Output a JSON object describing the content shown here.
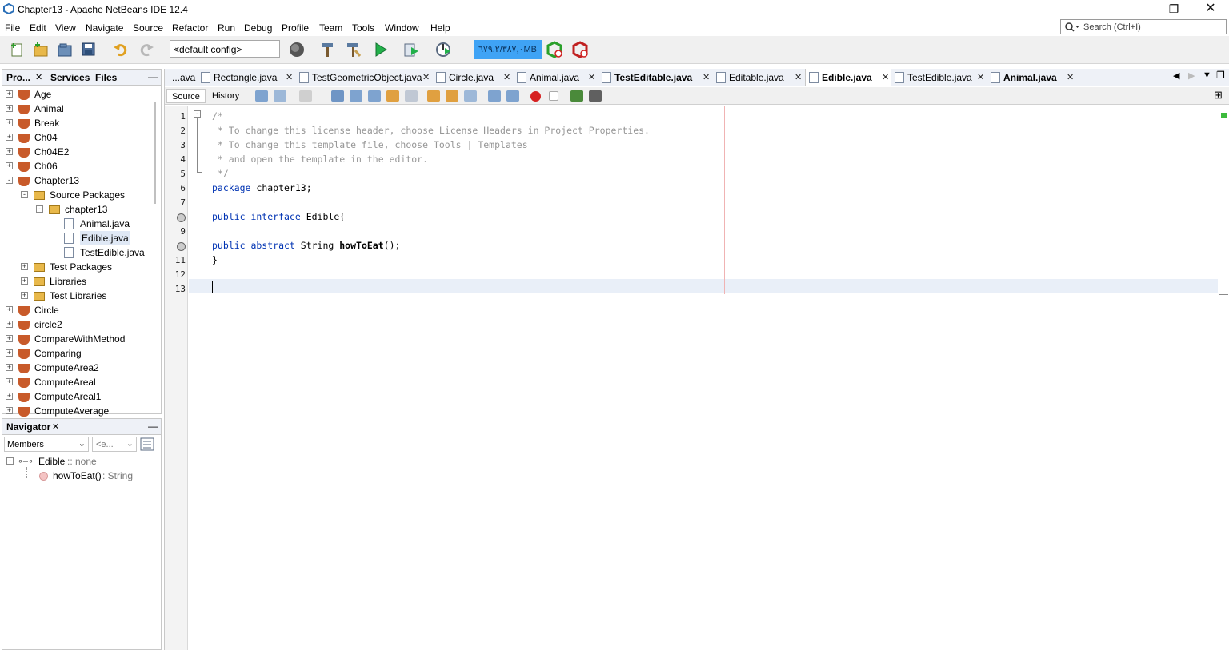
{
  "window": {
    "title": "Chapter13 - Apache NetBeans IDE 12.4"
  },
  "menu": [
    "File",
    "Edit",
    "View",
    "Navigate",
    "Source",
    "Refactor",
    "Run",
    "Debug",
    "Profile",
    "Team",
    "Tools",
    "Window",
    "Help"
  ],
  "search": {
    "placeholder": "Search (Ctrl+I)"
  },
  "toolbar": {
    "config": "<default config>",
    "memory": "٦٧٩.٢/٣٨٧,٠MB"
  },
  "projects_panel": {
    "tabs": [
      "Pro...",
      "Services",
      "Files"
    ],
    "items": [
      {
        "label": "Age",
        "level": 0,
        "exp": "+"
      },
      {
        "label": "Animal",
        "level": 0,
        "exp": "+"
      },
      {
        "label": "Break",
        "level": 0,
        "exp": "+"
      },
      {
        "label": "Ch04",
        "level": 0,
        "exp": "+"
      },
      {
        "label": "Ch04E2",
        "level": 0,
        "exp": "+"
      },
      {
        "label": "Ch06",
        "level": 0,
        "exp": "+"
      },
      {
        "label": "Chapter13",
        "level": 0,
        "exp": "-"
      },
      {
        "label": "Source Packages",
        "level": 1,
        "exp": "-"
      },
      {
        "label": "chapter13",
        "level": 2,
        "exp": "-"
      },
      {
        "label": "Animal.java",
        "level": 3,
        "exp": ""
      },
      {
        "label": "Edible.java",
        "level": 3,
        "exp": ""
      },
      {
        "label": "TestEdible.java",
        "level": 3,
        "exp": ""
      },
      {
        "label": "Test Packages",
        "level": 1,
        "exp": "+"
      },
      {
        "label": "Libraries",
        "level": 1,
        "exp": "+"
      },
      {
        "label": "Test Libraries",
        "level": 1,
        "exp": "+"
      },
      {
        "label": "Circle",
        "level": 0,
        "exp": "+"
      },
      {
        "label": "circle2",
        "level": 0,
        "exp": "+"
      },
      {
        "label": "CompareWithMethod",
        "level": 0,
        "exp": "+"
      },
      {
        "label": "Comparing",
        "level": 0,
        "exp": "+"
      },
      {
        "label": "ComputeArea2",
        "level": 0,
        "exp": "+"
      },
      {
        "label": "ComputeAreal",
        "level": 0,
        "exp": "+"
      },
      {
        "label": "ComputeAreal1",
        "level": 0,
        "exp": "+"
      },
      {
        "label": "ComputeAverage",
        "level": 0,
        "exp": "+"
      }
    ]
  },
  "navigator": {
    "title": "Navigator",
    "filter": "Members",
    "filter2": "<e...",
    "root": "Edible",
    "root_suffix": " :: none",
    "method": "howToEat()",
    "method_suffix": " : String"
  },
  "editor": {
    "tabs": [
      {
        "label": "...ava",
        "bold": false
      },
      {
        "label": "Rectangle.java",
        "bold": false
      },
      {
        "label": "TestGeometricObject.java",
        "bold": false
      },
      {
        "label": "Circle.java",
        "bold": false
      },
      {
        "label": "Animal.java",
        "bold": false
      },
      {
        "label": "TestEditable.java",
        "bold": true
      },
      {
        "label": "Editable.java",
        "bold": false
      },
      {
        "label": "Edible.java",
        "bold": true,
        "active": true
      },
      {
        "label": "TestEdible.java",
        "bold": false
      },
      {
        "label": "Animal.java",
        "bold": true
      }
    ],
    "view_tabs": [
      "Source",
      "History"
    ],
    "lines": [
      {
        "n": "1",
        "segs": [
          {
            "t": "/*",
            "c": "cm"
          }
        ]
      },
      {
        "n": "2",
        "segs": [
          {
            "t": " * To change this license header, choose License Headers in Project Properties.",
            "c": "cm"
          }
        ]
      },
      {
        "n": "3",
        "segs": [
          {
            "t": " * To change this template file, choose Tools | Templates",
            "c": "cm"
          }
        ]
      },
      {
        "n": "4",
        "segs": [
          {
            "t": " * and open the template in the editor.",
            "c": "cm"
          }
        ]
      },
      {
        "n": "5",
        "segs": [
          {
            "t": " */",
            "c": "cm"
          }
        ]
      },
      {
        "n": "6",
        "segs": [
          {
            "t": "package",
            "c": "kw"
          },
          {
            "t": " chapter13;",
            "c": ""
          }
        ]
      },
      {
        "n": "7",
        "segs": []
      },
      {
        "n": "",
        "segs": [
          {
            "t": "public interface",
            "c": "kw"
          },
          {
            "t": " Edible{",
            "c": ""
          }
        ]
      },
      {
        "n": "9",
        "segs": []
      },
      {
        "n": "",
        "segs": [
          {
            "t": "public abstract",
            "c": "kw"
          },
          {
            "t": " String ",
            "c": ""
          },
          {
            "t": "howToEat",
            "c": "b"
          },
          {
            "t": "();",
            "c": ""
          }
        ]
      },
      {
        "n": "11",
        "segs": [
          {
            "t": "}",
            "c": ""
          }
        ]
      },
      {
        "n": "12",
        "segs": []
      },
      {
        "n": "13",
        "segs": []
      }
    ]
  }
}
